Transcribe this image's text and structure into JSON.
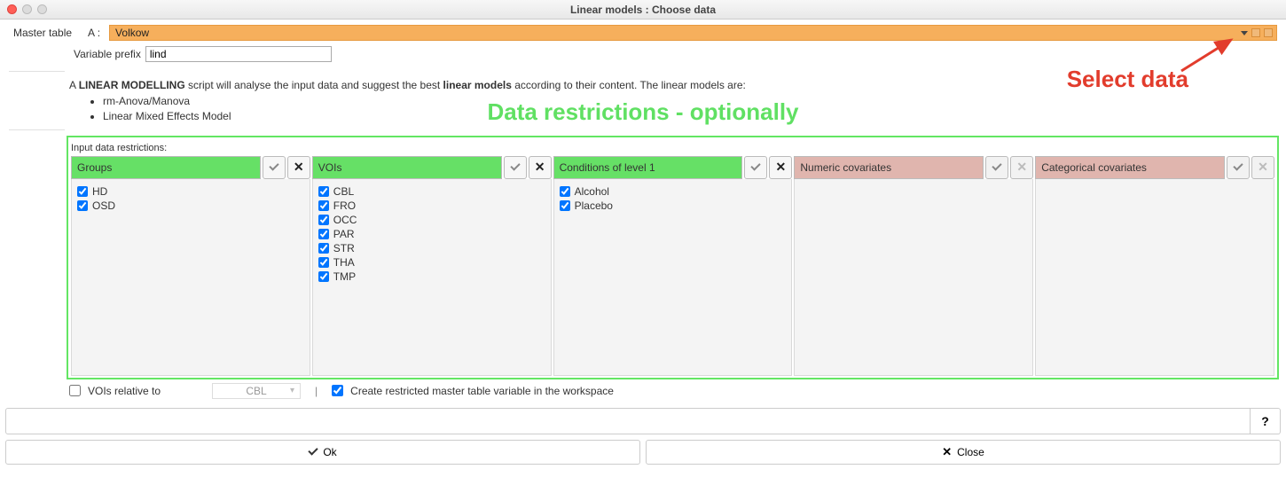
{
  "window": {
    "title": "Linear models :  Choose data"
  },
  "master": {
    "label": "Master table",
    "a_label": "A :",
    "value": "Volkow"
  },
  "prefix": {
    "label": "Variable prefix",
    "value": "lind"
  },
  "description": {
    "prefix_a": "A ",
    "bold1": "LINEAR MODELLING",
    "mid": " script will analyse the input data and suggest the best ",
    "bold2": "linear models",
    "suffix": " according to their content. The linear models are:",
    "bullet1": "rm-Anova/Manova",
    "bullet2": "Linear Mixed Effects Model"
  },
  "overlay": {
    "data_restrictions": "Data restrictions - optionally",
    "select_data": "Select data"
  },
  "restrictions": {
    "heading": "Input data restrictions:",
    "groups": {
      "title": "Groups",
      "items": [
        "HD",
        "OSD"
      ]
    },
    "vois": {
      "title": "VOIs",
      "items": [
        "CBL",
        "FRO",
        "OCC",
        "PAR",
        "STR",
        "THA",
        "TMP"
      ]
    },
    "conditions": {
      "title": "Conditions of level 1",
      "items": [
        "Alcohol",
        "Placebo"
      ]
    },
    "numeric": {
      "title": "Numeric covariates"
    },
    "categorical": {
      "title": "Categorical covariates"
    }
  },
  "options": {
    "vois_relative": "VOIs relative to",
    "vois_relative_value": "CBL",
    "create_restricted": "Create restricted master table variable in the workspace"
  },
  "footer": {
    "help": "?",
    "ok": "Ok",
    "close": "Close"
  }
}
